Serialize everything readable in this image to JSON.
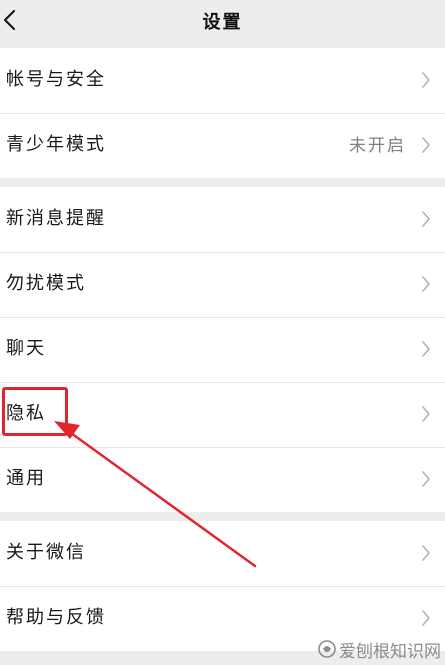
{
  "header": {
    "title": "设置",
    "back_icon": "chevron-left-icon"
  },
  "groups": [
    {
      "items": [
        {
          "label": "帐号与安全",
          "value": ""
        },
        {
          "label": "青少年模式",
          "value": "未开启"
        }
      ]
    },
    {
      "items": [
        {
          "label": "新消息提醒",
          "value": ""
        },
        {
          "label": "勿扰模式",
          "value": ""
        },
        {
          "label": "聊天",
          "value": ""
        },
        {
          "label": "隐私",
          "value": ""
        },
        {
          "label": "通用",
          "value": ""
        }
      ]
    },
    {
      "items": [
        {
          "label": "关于微信",
          "value": ""
        },
        {
          "label": "帮助与反馈",
          "value": ""
        }
      ]
    }
  ],
  "annotation": {
    "highlight_color": "#e0262c",
    "highlighted_item": "隐私"
  },
  "watermark": {
    "text": "爱刨根知识网"
  },
  "colors": {
    "background": "#ededed",
    "row_background": "#ffffff",
    "divider": "#e6e6e6",
    "label": "#191919",
    "secondary": "#7f7f7f",
    "chevron": "#b2b2b2"
  }
}
